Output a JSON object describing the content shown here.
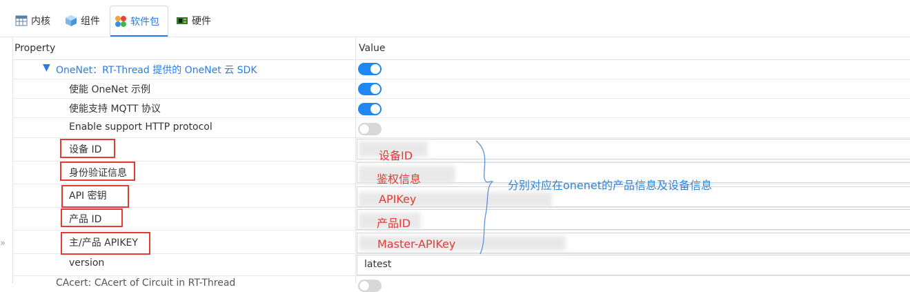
{
  "tabs": [
    {
      "label": "内核",
      "icon": "table-icon"
    },
    {
      "label": "组件",
      "icon": "cube-icon"
    },
    {
      "label": "软件包",
      "icon": "flower-icon",
      "active": true
    },
    {
      "label": "硬件",
      "icon": "circuit-board-icon"
    }
  ],
  "table": {
    "header_property": "Property",
    "header_value": "Value",
    "rows": [
      {
        "label": "OneNet：RT-Thread 提供的 OneNet 云 SDK",
        "type": "toggle",
        "value": true
      },
      {
        "label": "使能 OneNet 示例",
        "type": "toggle",
        "value": true
      },
      {
        "label": "使能支持 MQTT 协议",
        "type": "toggle",
        "value": true
      },
      {
        "label": "Enable support HTTP protocol",
        "type": "toggle",
        "value": false
      },
      {
        "label": "设备 ID",
        "type": "text",
        "value": ""
      },
      {
        "label": "身份验证信息",
        "type": "text",
        "value": ""
      },
      {
        "label": "API 密钥",
        "type": "text",
        "value": ""
      },
      {
        "label": "产品 ID",
        "type": "text",
        "value": ""
      },
      {
        "label": "主/产品 APIKEY",
        "type": "text",
        "value": ""
      },
      {
        "label": "version",
        "type": "text",
        "value": "latest"
      },
      {
        "label": "CAcert: CAcert of Circuit in RT-Thread",
        "type": "toggle",
        "value": false
      }
    ]
  },
  "annotations": {
    "device_id": "设备ID",
    "auth_info": "鉴权信息",
    "api_key": "APIKey",
    "product_id": "产品ID",
    "master_api_key": "Master-APIKey",
    "note": "分别对应在onenet的产品信息及设备信息"
  },
  "colors": {
    "accent": "#2c7be5",
    "toggle_on": "#1e88f0",
    "annotation_red": "#e53935",
    "note_blue": "#2f86d6"
  }
}
